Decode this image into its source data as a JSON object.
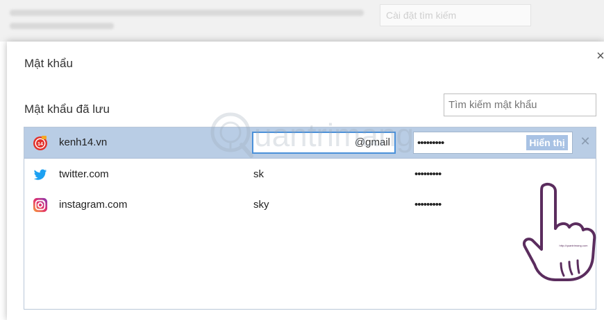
{
  "background": {
    "search_placeholder": "Cài đặt tìm kiếm"
  },
  "dialog": {
    "title": "Mật khẩu",
    "close_label": "×",
    "section_title": "Mật khẩu đã lưu",
    "search_placeholder": "Tìm kiếm mật khẩu",
    "entries": [
      {
        "site": "kenh14.vn",
        "username": "@gmail",
        "password": "•••••••••",
        "icon": "kenh14-icon",
        "show_label": "Hiển thị",
        "remove_label": "✕"
      },
      {
        "site": "twitter.com",
        "username": "sk",
        "password": "•••••••••",
        "icon": "twitter-icon"
      },
      {
        "site": "instagram.com",
        "username": "sky",
        "password": "•••••••••",
        "icon": "instagram-icon"
      }
    ]
  },
  "overlay": {
    "watermark_text": "uantrimang",
    "hand_caption": "http://quantrimang.com"
  },
  "colors": {
    "selected_row": "#b9cde5",
    "input_focus": "#4a90d9",
    "show_button": "#a8c2e4",
    "twitter": "#1da1f2",
    "kenh14": "#e2312b"
  }
}
